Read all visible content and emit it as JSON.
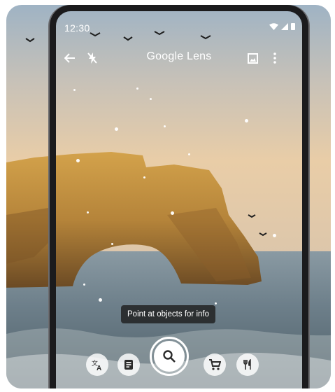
{
  "status_bar": {
    "time": "12:30"
  },
  "toolbar": {
    "title": "Google Lens"
  },
  "hint": {
    "text": "Point at objects for info"
  },
  "modes": [
    {
      "name": "translate",
      "icon": "translate-icon"
    },
    {
      "name": "text",
      "icon": "text-document-icon"
    },
    {
      "name": "search",
      "icon": "search-icon"
    },
    {
      "name": "shopping",
      "icon": "shopping-cart-icon"
    },
    {
      "name": "dining",
      "icon": "fork-knife-icon"
    }
  ],
  "colors": {
    "sky_top": "#9fb3c4",
    "sky_horizon": "#e9cda7",
    "rock": "#b5843a",
    "sea": "#6d7f8a",
    "chip_icon": "#2b2b2b"
  }
}
